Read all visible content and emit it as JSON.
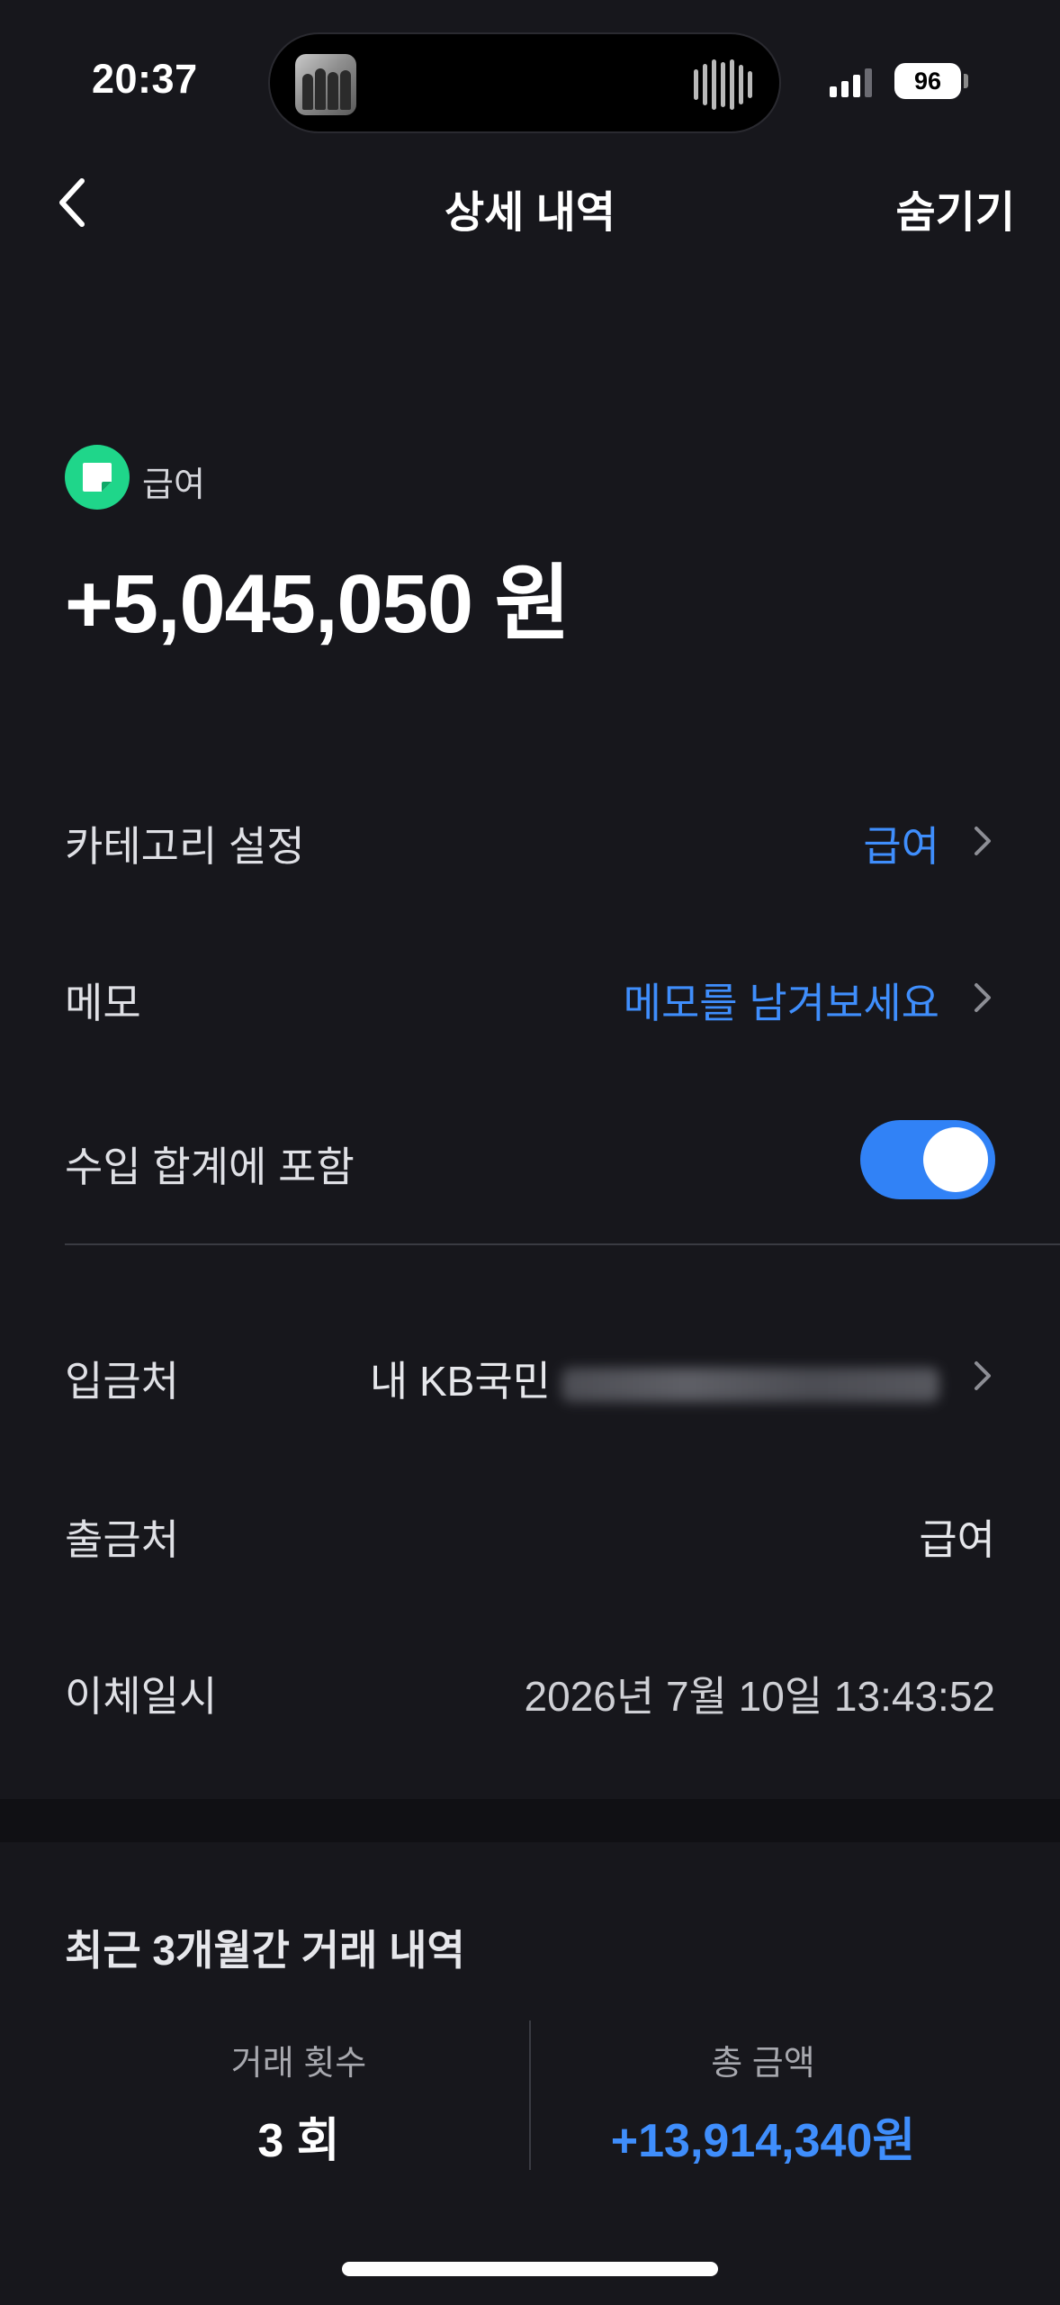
{
  "status_bar": {
    "time": "20:37",
    "battery": "96",
    "now_playing_icon": "album-art-icon",
    "waveform_icon": "audio-waveform-icon"
  },
  "nav": {
    "back_icon": "chevron-left-icon",
    "title": "상세 내역",
    "hide_label": "숨기기"
  },
  "hero": {
    "category_icon": "salary-icon",
    "category_label": "급여",
    "amount": "+5,045,050 원"
  },
  "details": {
    "category": {
      "label": "카테고리 설정",
      "value": "급여"
    },
    "memo": {
      "label": "메모",
      "value": "메모를 남겨보세요"
    },
    "include_income": {
      "label": "수입 합계에 포함",
      "enabled": true
    },
    "deposit_to": {
      "label": "입금처",
      "value": "내 KB국민"
    },
    "withdraw_from": {
      "label": "출금처",
      "value": "급여"
    },
    "transfer_datetime": {
      "label": "이체일시",
      "value": "2026년 7월 10일 13:43:52"
    }
  },
  "history": {
    "title": "최근 3개월간 거래 내역",
    "count_label": "거래 횟수",
    "count_value": "3 회",
    "total_label": "총 금액",
    "total_value": "+13,914,340원"
  },
  "colors": {
    "background": "#17171c",
    "accent_blue": "#3f8efc",
    "toggle_on": "#3182f6",
    "category_green": "#1fd68a"
  }
}
